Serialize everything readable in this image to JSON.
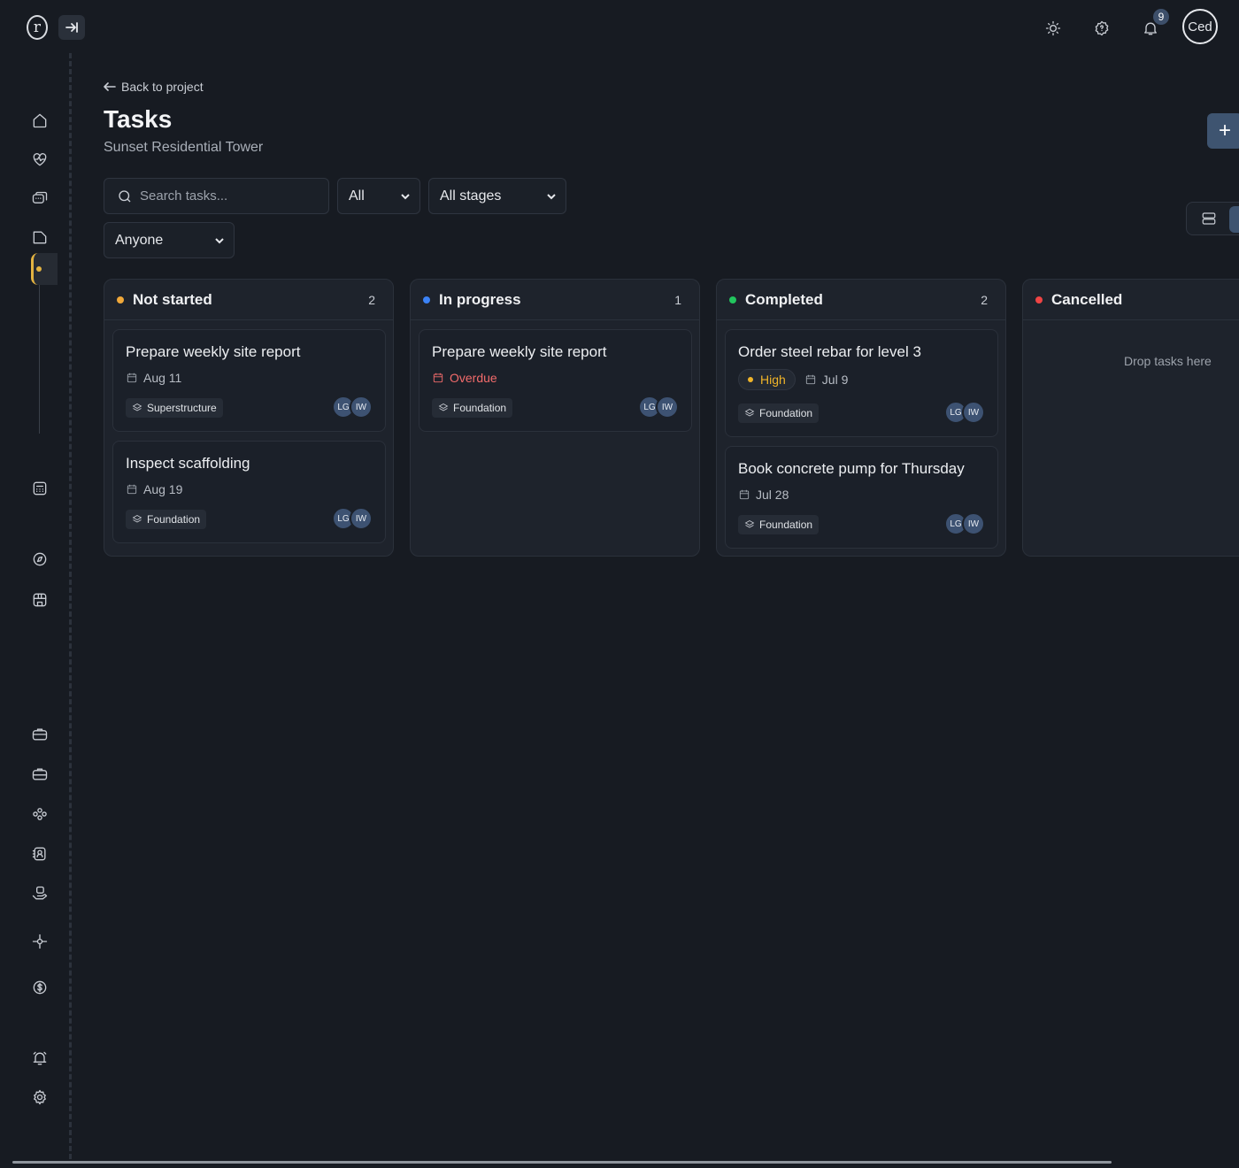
{
  "app": {
    "logo_letter": "r",
    "user_initials": "Ced",
    "notifications_count": "9"
  },
  "header": {
    "back_label": "Back to project",
    "title": "Tasks",
    "subtitle": "Sunset Residential Tower",
    "add_label": "+"
  },
  "filters": {
    "search_placeholder": "Search tasks...",
    "status_value": "All",
    "stage_value": "All stages",
    "assignee_value": "Anyone"
  },
  "columns": [
    {
      "title": "Not started",
      "count": "2",
      "color": "#f0a83a",
      "cards": [
        {
          "title": "Prepare weekly site report",
          "date": "Aug 11",
          "stage": "Superstructure",
          "assignees": [
            "LG",
            "IW"
          ]
        },
        {
          "title": "Inspect scaffolding",
          "date": "Aug 19",
          "stage": "Foundation",
          "assignees": [
            "LG",
            "IW"
          ]
        }
      ]
    },
    {
      "title": "In progress",
      "count": "1",
      "color": "#3b82f6",
      "cards": [
        {
          "title": "Prepare weekly site report",
          "date": "Overdue",
          "stage": "Foundation",
          "assignees": [
            "LG",
            "IW"
          ]
        }
      ]
    },
    {
      "title": "Completed",
      "count": "2",
      "color": "#22c55e",
      "cards": [
        {
          "title": "Order steel rebar for level 3",
          "priority": "High",
          "date": "Jul 9",
          "stage": "Foundation",
          "assignees": [
            "LG",
            "IW"
          ]
        },
        {
          "title": "Book concrete pump for Thursday",
          "date": "Jul 28",
          "stage": "Foundation",
          "assignees": [
            "LG",
            "IW"
          ]
        }
      ]
    },
    {
      "title": "Cancelled",
      "color": "#ef4444",
      "empty_label": "Drop tasks here"
    }
  ]
}
